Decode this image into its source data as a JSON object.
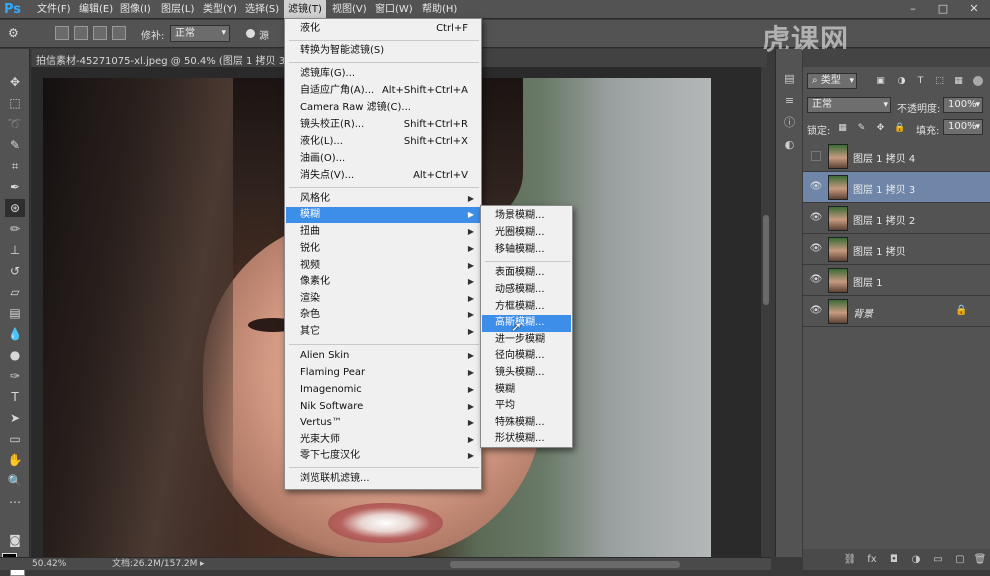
{
  "menubar": {
    "logo": "Ps",
    "items": [
      "文件(F)",
      "编辑(E)",
      "图像(I)",
      "图层(L)",
      "类型(Y)",
      "选择(S)",
      "滤镜(T)",
      "视图(V)",
      "窗口(W)",
      "帮助(H)"
    ],
    "active_index": 6
  },
  "options": {
    "repair_label": "修补:",
    "repair_mode": "正常",
    "source_label": "源"
  },
  "watermark": {
    "brand": "虎课网"
  },
  "document": {
    "tab_label": "拍信素材-45271075-xl.jpeg @ 50.4% (图层 1 拷贝 3, RGB/8)"
  },
  "status": {
    "zoom": "50.42%",
    "doc_info": "文档:26.2M/157.2M"
  },
  "filter_menu": {
    "top_items": [
      {
        "label": "液化",
        "shortcut": "Ctrl+F"
      },
      {
        "label": "转换为智能滤镜(S)",
        "shortcut": ""
      },
      {
        "label": "滤镜库(G)...",
        "shortcut": ""
      },
      {
        "label": "自适应广角(A)...",
        "shortcut": "Alt+Shift+Ctrl+A"
      },
      {
        "label": "Camera Raw 滤镜(C)...",
        "shortcut": ""
      },
      {
        "label": "镜头校正(R)...",
        "shortcut": "Shift+Ctrl+R"
      },
      {
        "label": "液化(L)...",
        "shortcut": "Shift+Ctrl+X"
      },
      {
        "label": "油画(O)...",
        "shortcut": ""
      },
      {
        "label": "消失点(V)...",
        "shortcut": "Alt+Ctrl+V"
      }
    ],
    "submenus_a": [
      "风格化",
      "模糊",
      "扭曲",
      "锐化",
      "视频",
      "像素化",
      "渲染",
      "杂色",
      "其它"
    ],
    "submenus_b": [
      "Alien Skin",
      "Flaming Pear",
      "Imagenomic",
      "Nik Software",
      "Vertus™",
      "光束大师",
      "零下七度汉化"
    ],
    "browse": "浏览联机滤镜..."
  },
  "blur_menu": {
    "group1": [
      "场景模糊...",
      "光圈模糊...",
      "移轴模糊..."
    ],
    "group2": [
      "表面模糊...",
      "动感模糊...",
      "方框模糊...",
      "高斯模糊...",
      "进一步模糊",
      "径向模糊...",
      "镜头模糊...",
      "模糊",
      "平均",
      "特殊模糊...",
      "形状模糊..."
    ],
    "highlighted": "高斯模糊..."
  },
  "layers_panel": {
    "kind_label": "类型",
    "blend_mode": "正常",
    "opacity_label": "不透明度:",
    "opacity_value": "100%",
    "lock_label": "锁定:",
    "fill_label": "填充:",
    "fill_value": "100%",
    "layers": [
      {
        "name": "图层 1 拷贝 4",
        "visible": false,
        "selected": false
      },
      {
        "name": "图层 1 拷贝 3",
        "visible": true,
        "selected": true
      },
      {
        "name": "图层 1 拷贝 2",
        "visible": true,
        "selected": false
      },
      {
        "name": "图层 1 拷贝",
        "visible": true,
        "selected": false
      },
      {
        "name": "图层 1",
        "visible": true,
        "selected": false
      },
      {
        "name": "背景",
        "visible": true,
        "selected": false,
        "locked": true
      }
    ]
  }
}
